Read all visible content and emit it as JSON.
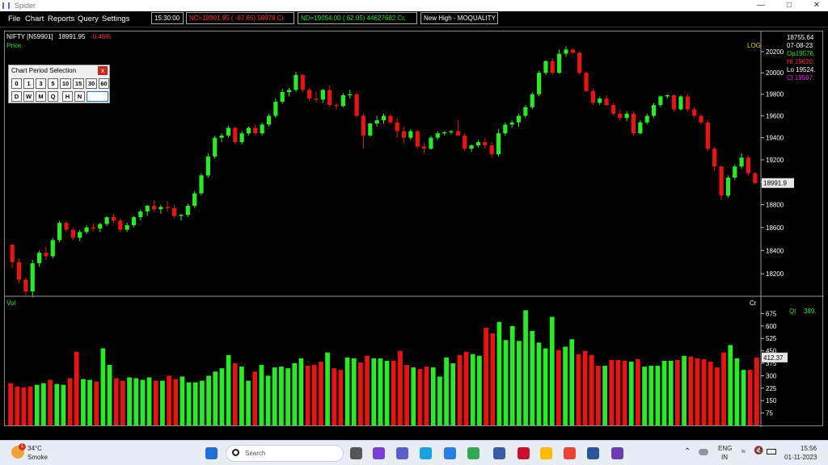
{
  "window": {
    "title": "Spider"
  },
  "menu": [
    "File",
    "Chart",
    "Reports",
    "Query",
    "Settings"
  ],
  "tickers": [
    {
      "text": "15:30:00",
      "color": "#ffffff"
    },
    {
      "text": "NC=18991.95 ( -87.65) 58978 Cr.",
      "color": "#ff3030"
    },
    {
      "text": "ND=19054.00 (  62.05) 44627682 Cr.",
      "color": "#20e020"
    },
    {
      "text": "New High - MOQUALITY",
      "color": "#ffffff"
    }
  ],
  "chart_header": {
    "symbol": "NIFTY [N59901]",
    "last": "18991.95",
    "change": "-0.46%",
    "price_label": "Price",
    "scale_label": "LOG",
    "vol_label": "Vol",
    "vol_unit": "Cr",
    "qt_label": "Qt",
    "qt_value": "389."
  },
  "info_panel": {
    "top_value": "18755.64",
    "date": "07-08-23",
    "op": "Op19576.",
    "hi": "Hi 19620.",
    "lo": "Lo 19524.",
    "cl": "Cl  19597."
  },
  "price_tag": "18991.9",
  "vol_tag": "412.37",
  "period_dialog": {
    "title": "Chart Period Selection",
    "close": "x",
    "row1": [
      "0",
      "1",
      "3",
      "5",
      "10",
      "15",
      "30",
      "60"
    ],
    "row2": [
      "D",
      "W",
      "M",
      "Q",
      "H",
      "N"
    ]
  },
  "colors": {
    "up": "#22ee22",
    "down": "#ee1111",
    "axis_text": "#ffffff"
  },
  "chart_data": [
    {
      "type": "candlestick",
      "ylabel": "Price",
      "scale": "log",
      "yticks": [
        18200,
        18400,
        18600,
        18800,
        19000,
        19200,
        19400,
        19600,
        19800,
        20000,
        20200
      ],
      "ylim": [
        18050,
        20330
      ],
      "ohlc": [
        [
          18450,
          18460,
          18250,
          18300
        ],
        [
          18300,
          18330,
          18120,
          18150
        ],
        [
          18150,
          18170,
          18020,
          18050
        ],
        [
          18050,
          18320,
          18000,
          18290
        ],
        [
          18290,
          18400,
          18260,
          18380
        ],
        [
          18380,
          18430,
          18320,
          18350
        ],
        [
          18350,
          18510,
          18330,
          18490
        ],
        [
          18490,
          18660,
          18470,
          18640
        ],
        [
          18640,
          18660,
          18560,
          18580
        ],
        [
          18580,
          18600,
          18490,
          18510
        ],
        [
          18510,
          18580,
          18480,
          18560
        ],
        [
          18560,
          18620,
          18540,
          18600
        ],
        [
          18600,
          18630,
          18570,
          18590
        ],
        [
          18590,
          18640,
          18560,
          18630
        ],
        [
          18630,
          18700,
          18610,
          18690
        ],
        [
          18690,
          18720,
          18640,
          18660
        ],
        [
          18660,
          18680,
          18560,
          18580
        ],
        [
          18580,
          18640,
          18560,
          18620
        ],
        [
          18620,
          18700,
          18600,
          18690
        ],
        [
          18690,
          18760,
          18660,
          18740
        ],
        [
          18740,
          18800,
          18700,
          18790
        ],
        [
          18790,
          18840,
          18740,
          18760
        ],
        [
          18760,
          18800,
          18720,
          18780
        ],
        [
          18780,
          18830,
          18740,
          18770
        ],
        [
          18770,
          18800,
          18680,
          18700
        ],
        [
          18700,
          18720,
          18660,
          18710
        ],
        [
          18710,
          18810,
          18690,
          18790
        ],
        [
          18790,
          18920,
          18770,
          18900
        ],
        [
          18900,
          19080,
          18880,
          19060
        ],
        [
          19060,
          19260,
          19040,
          19230
        ],
        [
          19230,
          19420,
          19210,
          19400
        ],
        [
          19400,
          19440,
          19360,
          19420
        ],
        [
          19420,
          19510,
          19400,
          19490
        ],
        [
          19490,
          19500,
          19340,
          19360
        ],
        [
          19360,
          19460,
          19340,
          19440
        ],
        [
          19440,
          19500,
          19420,
          19490
        ],
        [
          19490,
          19520,
          19420,
          19440
        ],
        [
          19440,
          19540,
          19420,
          19520
        ],
        [
          19520,
          19620,
          19500,
          19600
        ],
        [
          19600,
          19760,
          19580,
          19730
        ],
        [
          19730,
          19850,
          19710,
          19820
        ],
        [
          19820,
          19860,
          19780,
          19840
        ],
        [
          19840,
          20010,
          19820,
          19980
        ],
        [
          19980,
          19990,
          19820,
          19840
        ],
        [
          19840,
          19860,
          19740,
          19760
        ],
        [
          19760,
          19820,
          19730,
          19750
        ],
        [
          19750,
          19850,
          19720,
          19840
        ],
        [
          19840,
          19880,
          19680,
          19700
        ],
        [
          19700,
          19720,
          19660,
          19690
        ],
        [
          19690,
          19810,
          19680,
          19790
        ],
        [
          19790,
          19840,
          19760,
          19800
        ],
        [
          19800,
          19820,
          19580,
          19600
        ],
        [
          19600,
          19620,
          19300,
          19420
        ],
        [
          19420,
          19540,
          19410,
          19530
        ],
        [
          19530,
          19600,
          19500,
          19560
        ],
        [
          19560,
          19620,
          19530,
          19600
        ],
        [
          19600,
          19620,
          19520,
          19540
        ],
        [
          19540,
          19580,
          19400,
          19460
        ],
        [
          19460,
          19500,
          19350,
          19400
        ],
        [
          19400,
          19480,
          19380,
          19460
        ],
        [
          19460,
          19470,
          19300,
          19320
        ],
        [
          19320,
          19350,
          19260,
          19300
        ],
        [
          19300,
          19420,
          19290,
          19400
        ],
        [
          19400,
          19460,
          19380,
          19440
        ],
        [
          19440,
          19460,
          19420,
          19450
        ],
        [
          19450,
          19470,
          19430,
          19460
        ],
        [
          19460,
          19560,
          19420,
          19420
        ],
        [
          19420,
          19440,
          19280,
          19300
        ],
        [
          19300,
          19340,
          19270,
          19330
        ],
        [
          19330,
          19380,
          19310,
          19360
        ],
        [
          19360,
          19400,
          19300,
          19330
        ],
        [
          19330,
          19360,
          19220,
          19250
        ],
        [
          19250,
          19480,
          19230,
          19440
        ],
        [
          19440,
          19540,
          19420,
          19520
        ],
        [
          19520,
          19560,
          19490,
          19540
        ],
        [
          19540,
          19620,
          19500,
          19600
        ],
        [
          19600,
          19700,
          19580,
          19680
        ],
        [
          19680,
          19820,
          19660,
          19800
        ],
        [
          19800,
          20020,
          19780,
          20000
        ],
        [
          20000,
          20120,
          19980,
          20110
        ],
        [
          20110,
          20140,
          19980,
          20000
        ],
        [
          20000,
          20220,
          19990,
          20180
        ],
        [
          20180,
          20250,
          20150,
          20220
        ],
        [
          20220,
          20230,
          20180,
          20190
        ],
        [
          20190,
          20200,
          19980,
          20000
        ],
        [
          20000,
          20010,
          19820,
          19830
        ],
        [
          19830,
          19850,
          19700,
          19720
        ],
        [
          19720,
          19780,
          19700,
          19760
        ],
        [
          19760,
          19790,
          19690,
          19700
        ],
        [
          19700,
          19720,
          19600,
          19620
        ],
        [
          19620,
          19660,
          19560,
          19580
        ],
        [
          19580,
          19640,
          19550,
          19620
        ],
        [
          19620,
          19640,
          19420,
          19440
        ],
        [
          19440,
          19560,
          19430,
          19540
        ],
        [
          19540,
          19620,
          19520,
          19600
        ],
        [
          19600,
          19720,
          19580,
          19700
        ],
        [
          19700,
          19790,
          19680,
          19780
        ],
        [
          19780,
          19800,
          19760,
          19790
        ],
        [
          19790,
          19800,
          19640,
          19660
        ],
        [
          19660,
          19790,
          19650,
          19780
        ],
        [
          19780,
          19800,
          19640,
          19660
        ],
        [
          19660,
          19680,
          19580,
          19600
        ],
        [
          19600,
          19620,
          19520,
          19540
        ],
        [
          19540,
          19560,
          19280,
          19300
        ],
        [
          19300,
          19320,
          19100,
          19140
        ],
        [
          19140,
          19150,
          18840,
          18880
        ],
        [
          18880,
          19060,
          18860,
          19040
        ],
        [
          19040,
          19160,
          19020,
          19140
        ],
        [
          19140,
          19260,
          19120,
          19220
        ],
        [
          19220,
          19240,
          19060,
          19080
        ],
        [
          19080,
          19090,
          18980,
          18992
        ]
      ]
    },
    {
      "type": "bar",
      "ylabel": "Vol",
      "ylim": [
        0,
        750
      ],
      "yticks": [
        75,
        150,
        225,
        300,
        375,
        450,
        525,
        600,
        675
      ],
      "values": [
        255,
        235,
        230,
        235,
        245,
        255,
        275,
        250,
        245,
        285,
        445,
        280,
        275,
        265,
        465,
        365,
        285,
        270,
        290,
        285,
        275,
        290,
        270,
        270,
        300,
        280,
        295,
        260,
        260,
        270,
        300,
        325,
        345,
        425,
        375,
        355,
        270,
        325,
        365,
        300,
        350,
        355,
        345,
        375,
        405,
        360,
        365,
        385,
        440,
        345,
        335,
        410,
        405,
        380,
        420,
        405,
        405,
        390,
        390,
        450,
        365,
        350,
        340,
        355,
        350,
        295,
        410,
        375,
        425,
        445,
        430,
        420,
        590,
        555,
        625,
        515,
        600,
        510,
        695,
        570,
        500,
        465,
        655,
        455,
        475,
        520,
        430,
        450,
        425,
        360,
        360,
        395,
        395,
        390,
        385,
        400,
        355,
        360,
        360,
        390,
        390,
        395,
        420,
        415,
        405,
        400,
        385,
        350,
        440,
        485,
        405,
        335,
        335,
        410
      ]
    }
  ],
  "taskbar": {
    "weather_temp": "34°C",
    "weather_desc": "Smoke",
    "weather_badge": "1",
    "search_placeholder": "Search",
    "lang_1": "ENG",
    "lang_2": "IN",
    "time": "15:56",
    "date": "01-11-2023",
    "icons": [
      {
        "name": "windows-start-icon",
        "color": "#1f6fd6"
      },
      {
        "name": "task-view-icon",
        "color": "#555555"
      },
      {
        "name": "meet-icon",
        "color": "#7b3fd6"
      },
      {
        "name": "teams-icon",
        "color": "#5b5fc7"
      },
      {
        "name": "edge-icon",
        "color": "#1ba1e2"
      },
      {
        "name": "store-icon",
        "color": "#2a7de1"
      },
      {
        "name": "chrome-icon",
        "color": "#34a853"
      },
      {
        "name": "calculator-icon",
        "color": "#3a5ba0"
      },
      {
        "name": "mcafee-icon",
        "color": "#c8102e"
      },
      {
        "name": "chrome-profile-icon",
        "color": "#fbbc05"
      },
      {
        "name": "chrome-alt-icon",
        "color": "#ea4335"
      },
      {
        "name": "word-icon",
        "color": "#2b579a"
      },
      {
        "name": "spider-app-icon",
        "color": "#6a3cb5"
      }
    ]
  }
}
